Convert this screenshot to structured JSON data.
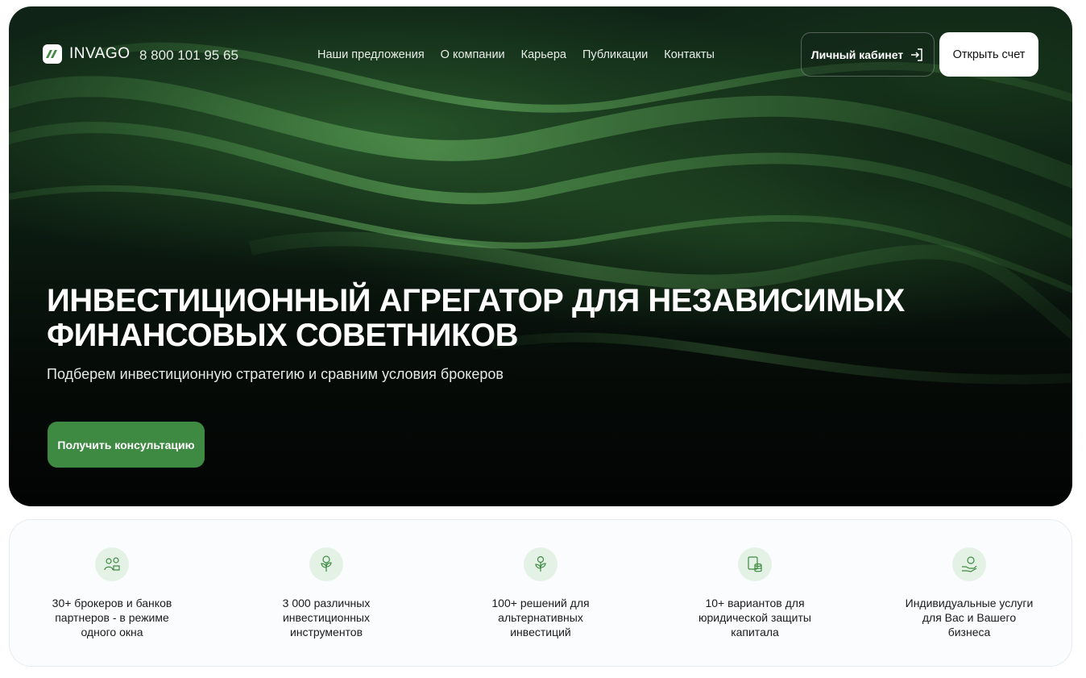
{
  "header": {
    "logo_text": "INVAGO",
    "phone": "8 800 101 95 65",
    "nav": [
      {
        "label": "Наши предложения"
      },
      {
        "label": "О компании"
      },
      {
        "label": "Карьера"
      },
      {
        "label": "Публикации"
      },
      {
        "label": "Контакты"
      }
    ],
    "cabinet_label": "Личный кабинет",
    "open_account_label": "Открыть счет"
  },
  "hero": {
    "title_line1": "Инвестиционный агрегатор для независимых",
    "title_line2": "финансовых советников",
    "subtitle": "Подберем инвестиционную стратегию и сравним условия брокеров",
    "cta_label": "Получить консультацию"
  },
  "features": [
    {
      "icon": "advisor-people-icon",
      "line1": "30+ брокеров и банков",
      "line2": "партнеров - в режиме",
      "line3": "одного окна"
    },
    {
      "icon": "money-plant-icon",
      "line1": "3 000 различных",
      "line2": "инвестиционных",
      "line3": "инструментов"
    },
    {
      "icon": "growth-sprout-icon",
      "line1": "100+ решений для",
      "line2": "альтернативных",
      "line3": "инвестиций"
    },
    {
      "icon": "coins-stack-icon",
      "line1": "10+ вариантов для",
      "line2": "юридической защиты",
      "line3": "капитала"
    },
    {
      "icon": "hand-coin-icon",
      "line1": "Индивидуальные услуги",
      "line2": "для Вас и Вашего",
      "line3": "бизнеса"
    }
  ],
  "colors": {
    "accent_green": "#3f8a42",
    "hero_dark": "#0b1a10",
    "feature_icon_bg": "#e4f2e6"
  }
}
